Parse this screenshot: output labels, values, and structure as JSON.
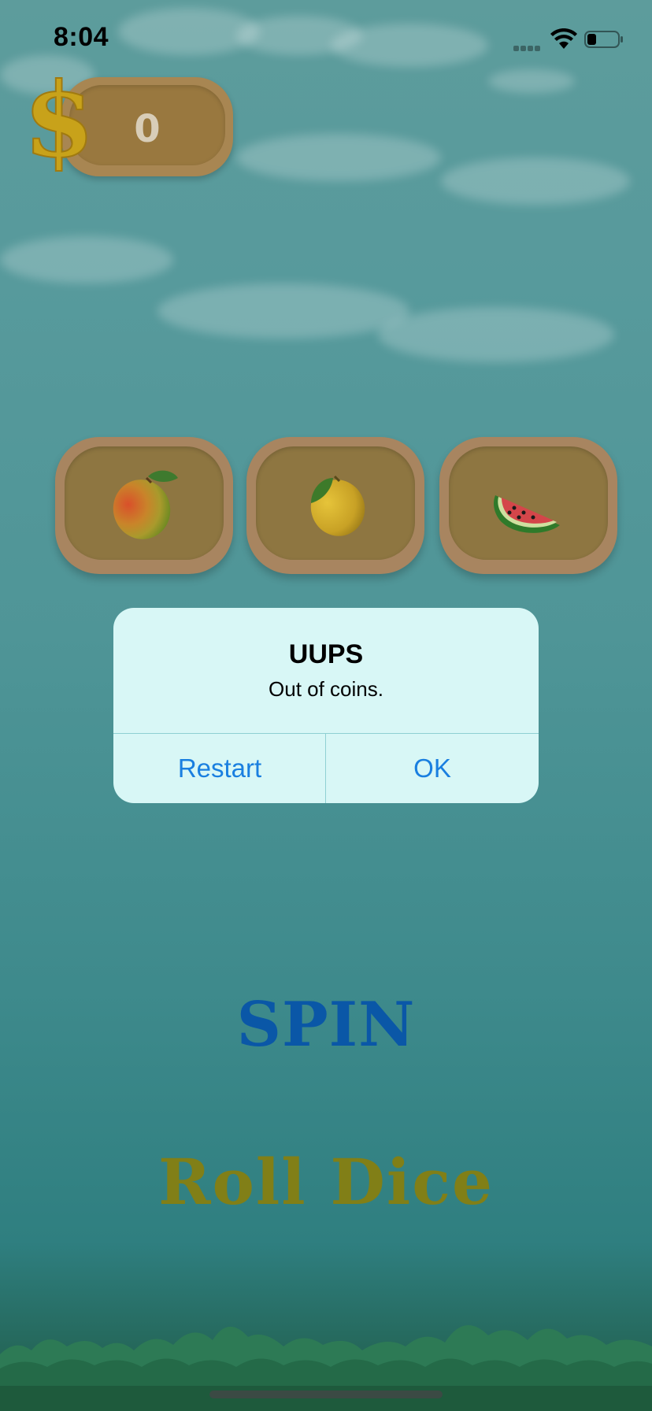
{
  "status_bar": {
    "time": "8:04"
  },
  "coins": {
    "value": "0",
    "currency_symbol": "$"
  },
  "slots": [
    {
      "fruit": "mango",
      "icon": "mango-icon"
    },
    {
      "fruit": "lemon",
      "icon": "lemon-icon"
    },
    {
      "fruit": "watermelon",
      "icon": "watermelon-icon"
    }
  ],
  "dialog": {
    "title": "UUPS",
    "message": "Out of coins.",
    "buttons": {
      "restart": "Restart",
      "ok": "OK"
    }
  },
  "actions": {
    "spin": "SPIN",
    "roll_dice": "Roll Dice"
  },
  "colors": {
    "dialog_background": "#d8f7f6",
    "dialog_button_text": "#1a7fe0",
    "spin_text": "#0a57a7",
    "roll_dice_text": "#817f17",
    "panel_wood": "#a88652"
  }
}
